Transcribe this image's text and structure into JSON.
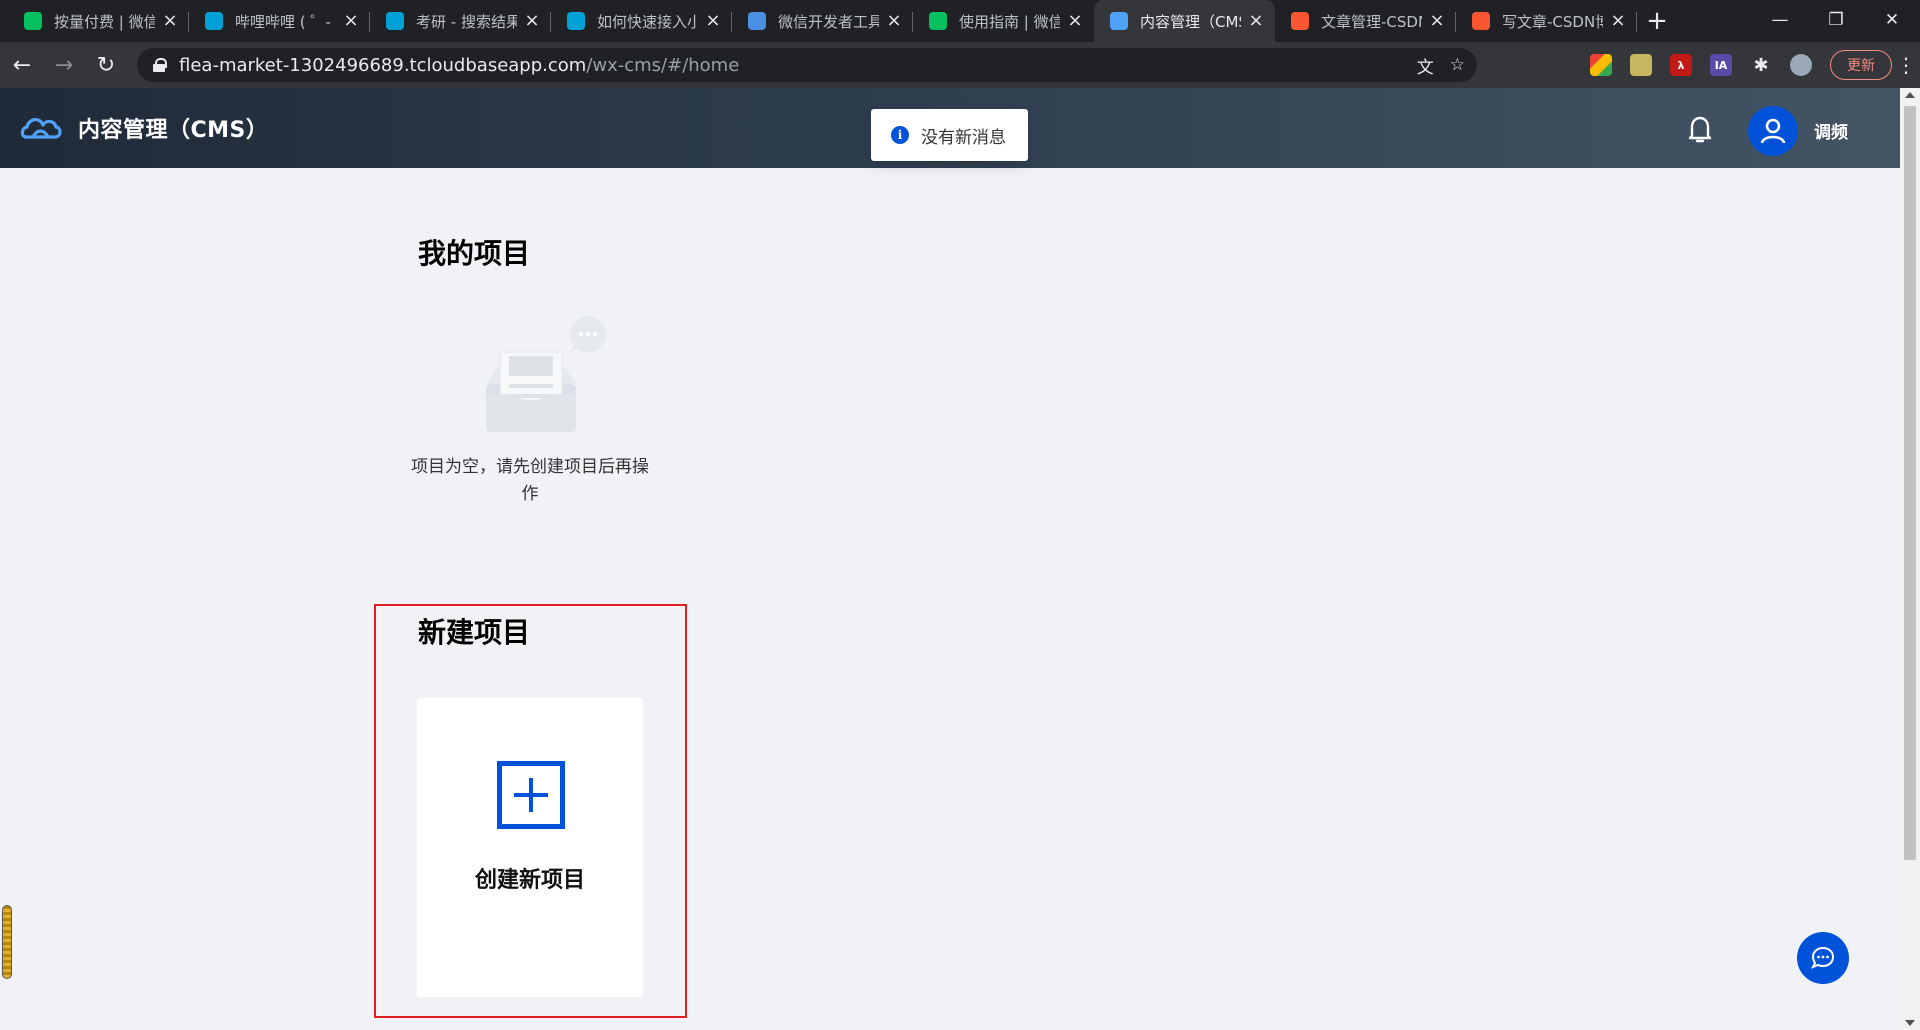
{
  "browser": {
    "tabs": [
      {
        "title": "按量付费 | 微信",
        "favicon": "wechat-icon",
        "color": "#07c160",
        "active": false
      },
      {
        "title": "哔哩哔哩 ( ゜- ゜)",
        "favicon": "bilibili-icon",
        "color": "#00a1d6",
        "active": false
      },
      {
        "title": "考研 - 搜索结果",
        "favicon": "bilibili-icon",
        "color": "#00a1d6",
        "active": false
      },
      {
        "title": "如何快速接入小程",
        "favicon": "bilibili-icon",
        "color": "#00a1d6",
        "active": false
      },
      {
        "title": "微信开发者工具",
        "favicon": "cloud-devtools-icon",
        "color": "#4a90e2",
        "active": false
      },
      {
        "title": "使用指南 | 微信",
        "favicon": "wechat-icon",
        "color": "#07c160",
        "active": false
      },
      {
        "title": "内容管理（CMS",
        "favicon": "cloud-logo-icon",
        "color": "#4fa3f7",
        "active": true
      },
      {
        "title": "文章管理-CSDN",
        "favicon": "csdn-icon",
        "color": "#fc5531",
        "active": false
      },
      {
        "title": "写文章-CSDN博",
        "favicon": "csdn-icon",
        "color": "#fc5531",
        "active": false
      }
    ],
    "new_tab_label": "+",
    "url_host": "flea-market-1302496689.tcloudbaseapp.com",
    "url_path": "/wx-cms/#/home",
    "update_label": "更新"
  },
  "header": {
    "app_title": "内容管理（CMS）",
    "username": "调频"
  },
  "toast": {
    "message": "没有新消息",
    "icon": "info-icon",
    "icon_glyph": "i"
  },
  "my_projects": {
    "title": "我的项目",
    "empty_text": "项目为空，请先创建项目后再操作"
  },
  "new_project": {
    "title": "新建项目",
    "create_label": "创建新项目"
  },
  "colors": {
    "brand_blue": "#0052d9",
    "highlight_red": "#e02020",
    "page_bg": "#f0f2f6"
  }
}
